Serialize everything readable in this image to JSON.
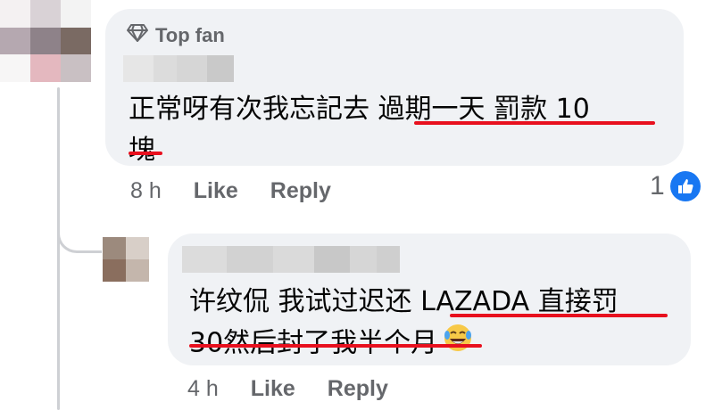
{
  "colors": {
    "bubble": "#f0f2f5",
    "meta_text": "#65676b",
    "primary_text": "#050505",
    "underline": "#e8101e",
    "like_blue": "#1877f2",
    "thread_line": "#ced0d4"
  },
  "comments": [
    {
      "badge_icon": "diamond-icon",
      "badge_label": "Top fan",
      "text_line1": "正常呀有次我忘記去 過期一天 罰款 10",
      "text_line2": "塊",
      "time": "8 h",
      "like_label": "Like",
      "reply_label": "Reply",
      "reaction_count": "1",
      "reaction_icon": "thumbs-up-icon"
    },
    {
      "text_line1": "许纹侃 我试过迟还 LAZADA 直接罚",
      "text_line2": "30然后封了我半个月",
      "emoji": "laughing-tears-emoji",
      "time": "4 h",
      "like_label": "Like",
      "reply_label": "Reply"
    }
  ]
}
